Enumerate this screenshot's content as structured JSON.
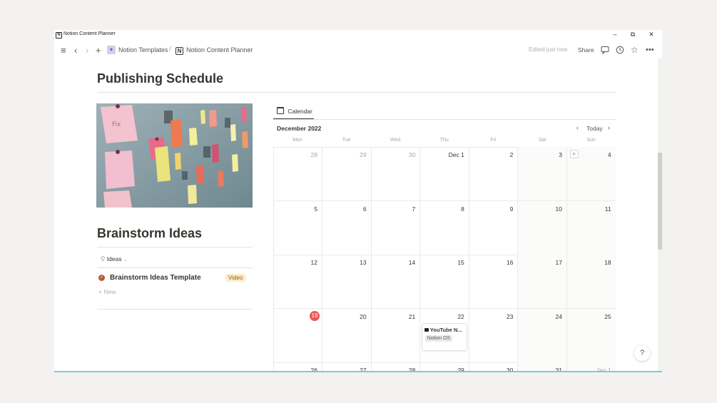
{
  "window": {
    "title": "Notion Content Planner"
  },
  "window_controls": {
    "minimize": "–",
    "restore": "⧉",
    "close": "✕"
  },
  "toolbar": {
    "breadcrumbs": [
      {
        "label": "Notion Templates",
        "icon": "pin-icon"
      },
      {
        "label": "Notion Content Planner",
        "icon": "notion-icon"
      }
    ],
    "separator": "/",
    "edited": "Edited just now",
    "share": "Share"
  },
  "main": {
    "publishing_title": "Publishing Schedule",
    "brainstorm_title": "Brainstorm Ideas",
    "ideas_view_label": "Ideas",
    "ideas_rows": [
      {
        "title": "Brainstorm Ideas Template",
        "tag": "Video"
      }
    ],
    "new_label": "New"
  },
  "calendar": {
    "tab_label": "Calendar",
    "month": "December 2022",
    "today_label": "Today",
    "weekdays": [
      "Mon",
      "Tue",
      "Wed",
      "Thu",
      "Fri",
      "Sat",
      "Sun"
    ],
    "weeks": [
      [
        "28",
        "29",
        "30",
        "Dec 1",
        "2",
        "3",
        "4"
      ],
      [
        "5",
        "6",
        "7",
        "8",
        "9",
        "10",
        "11"
      ],
      [
        "12",
        "13",
        "14",
        "15",
        "16",
        "17",
        "18"
      ],
      [
        "19",
        "20",
        "21",
        "22",
        "23",
        "24",
        "25"
      ],
      [
        "26",
        "27",
        "28",
        "29",
        "30",
        "31",
        "Jan 1"
      ]
    ],
    "event": {
      "title": "YouTube N...",
      "tag": "Notion OS"
    }
  },
  "help_label": "?",
  "colors": {
    "today": "#eb5757",
    "tag_video_bg": "#fbecc7",
    "accent_line": "#7ac9e6"
  }
}
